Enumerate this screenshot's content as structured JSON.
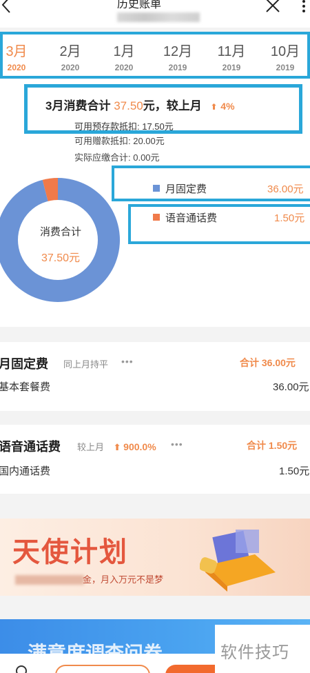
{
  "header": {
    "title": "历史账单"
  },
  "months": [
    {
      "month": "3月",
      "year": "2020",
      "active": true
    },
    {
      "month": "2月",
      "year": "2020",
      "active": false
    },
    {
      "month": "1月",
      "year": "2020",
      "active": false
    },
    {
      "month": "12月",
      "year": "2019",
      "active": false
    },
    {
      "month": "11月",
      "year": "2019",
      "active": false
    },
    {
      "month": "10月",
      "year": "2019",
      "active": false
    }
  ],
  "summary": {
    "prefix": "3月消费合计",
    "amount": "37.50",
    "suffix": "元，较上月",
    "arrow": "⬆",
    "percent": "4%",
    "prepaid_deduction": "可用预存款抵扣: 17.50元",
    "gift_deduction": "可用赠款抵扣: 20.00元",
    "actual_due": "实际应缴合计: 0.00元"
  },
  "donut": {
    "label": "消费合计",
    "value": "37.50元"
  },
  "chart_data": {
    "type": "pie",
    "categories": [
      "月固定费",
      "语音通话费"
    ],
    "values": [
      36.0,
      1.5
    ],
    "colors": [
      "#6b93d6",
      "#f07a4a"
    ]
  },
  "legend": [
    {
      "name": "月固定费",
      "value": "36.00元",
      "color": "#6b93d6"
    },
    {
      "name": "语音通话费",
      "value": "1.50元",
      "color": "#f07a4a"
    }
  ],
  "cards": [
    {
      "title": "月固定费",
      "compare": "同上月持平",
      "dots": "•••",
      "total": "合计 36.00元",
      "item": "基本套餐费",
      "item_value": "36.00元"
    },
    {
      "title": "语音通话费",
      "compare": "较上月",
      "arrow": "⬆",
      "percent": "900.0%",
      "dots": "•••",
      "total": "合计 1.50元",
      "item": "国内通话费",
      "item_value": "1.50元"
    }
  ],
  "banner1": {
    "title": "天使计划",
    "subtitle": "金，月入万元不是梦"
  },
  "banner2": {
    "title": "满意度调查问卷"
  },
  "watermark": "软件技巧",
  "colors": {
    "accent": "#f08a4b",
    "highlight_border": "#2aa7d9",
    "blue_segment": "#6b93d6",
    "orange_segment": "#f07a4a"
  }
}
